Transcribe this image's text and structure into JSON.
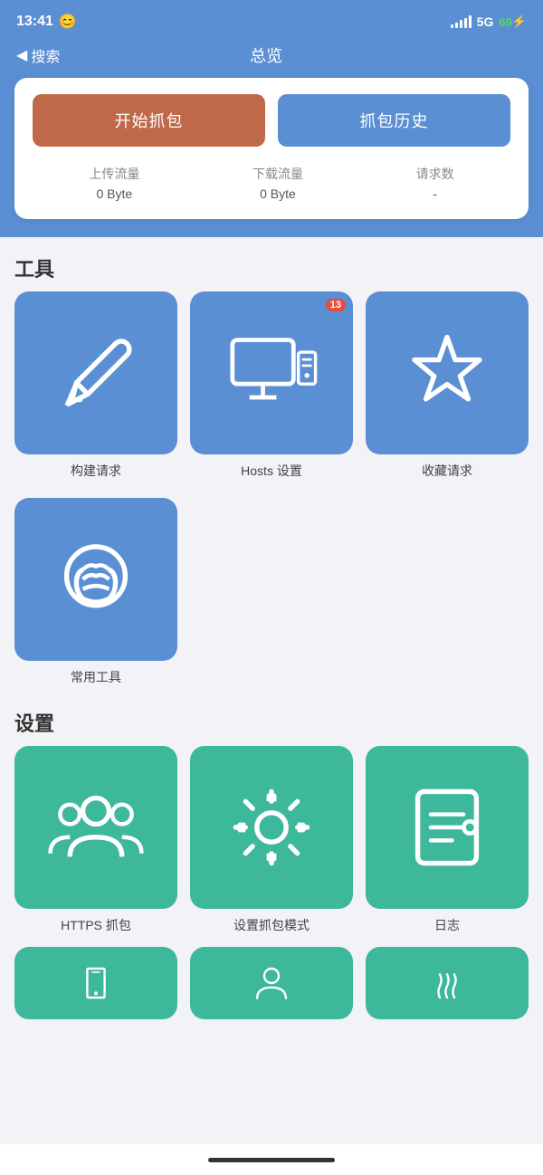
{
  "statusBar": {
    "time": "13:41",
    "emoji": "😊",
    "network": "5G",
    "battery": "69"
  },
  "navBar": {
    "back": "搜索",
    "title": "总览"
  },
  "card": {
    "startBtn": "开始抓包",
    "historyBtn": "抓包历史",
    "stats": [
      {
        "label": "上传流量",
        "value": "0 Byte"
      },
      {
        "label": "下载流量",
        "value": "0 Byte"
      },
      {
        "label": "请求数",
        "value": "-"
      }
    ]
  },
  "toolsSection": {
    "title": "工具",
    "items": [
      {
        "label": "构建请求",
        "icon": "pen"
      },
      {
        "label": "Hosts 设置",
        "icon": "monitor",
        "badge": "13"
      },
      {
        "label": "收藏请求",
        "icon": "star"
      }
    ],
    "extraItems": [
      {
        "label": "常用工具",
        "icon": "tools"
      }
    ]
  },
  "settingsSection": {
    "title": "设置",
    "items": [
      {
        "label": "HTTPS 抓包",
        "icon": "users"
      },
      {
        "label": "设置抓包模式",
        "icon": "gear"
      },
      {
        "label": "日志",
        "icon": "log"
      }
    ],
    "partialItems": [
      {
        "label": "",
        "icon": "phone"
      },
      {
        "label": "",
        "icon": "person"
      },
      {
        "label": "",
        "icon": "steam"
      }
    ]
  }
}
